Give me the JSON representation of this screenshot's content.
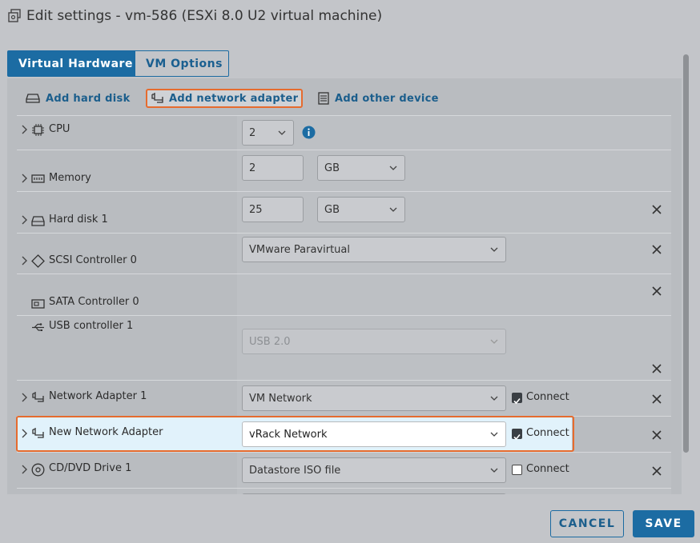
{
  "dialog": {
    "title": "Edit settings - vm-586 (ESXi 8.0 U2 virtual machine)"
  },
  "tabs": [
    {
      "label": "Virtual Hardware",
      "active": true
    },
    {
      "label": "VM Options",
      "active": false
    }
  ],
  "toolbar": {
    "add_hard_disk": "Add hard disk",
    "add_network_adapter": "Add network adapter",
    "add_other_device": "Add other device"
  },
  "rows": {
    "cpu": {
      "label": "CPU",
      "value": "2"
    },
    "memory": {
      "label": "Memory",
      "value": "2",
      "unit": "GB"
    },
    "hard_disk": {
      "label": "Hard disk 1",
      "value": "25",
      "unit": "GB"
    },
    "scsi": {
      "label": "SCSI Controller 0",
      "value": "VMware Paravirtual"
    },
    "sata": {
      "label": "SATA Controller 0"
    },
    "usb": {
      "label": "USB controller 1",
      "value": "USB 2.0"
    },
    "net1": {
      "label": "Network Adapter 1",
      "value": "VM Network",
      "connect_label": "Connect",
      "connected": true
    },
    "new_net": {
      "label": "New Network Adapter",
      "value": "vRack Network",
      "connect_label": "Connect",
      "connected": true
    },
    "cdrom": {
      "label": "CD/DVD Drive 1",
      "value": "Datastore ISO file",
      "connect_label": "Connect",
      "connected": false
    }
  },
  "footer": {
    "cancel_label": "CANCEL",
    "save_label": "SAVE"
  },
  "colors": {
    "accent": "#1c6ca3",
    "highlight": "#e66b2e",
    "background": "#c3c5c9"
  }
}
